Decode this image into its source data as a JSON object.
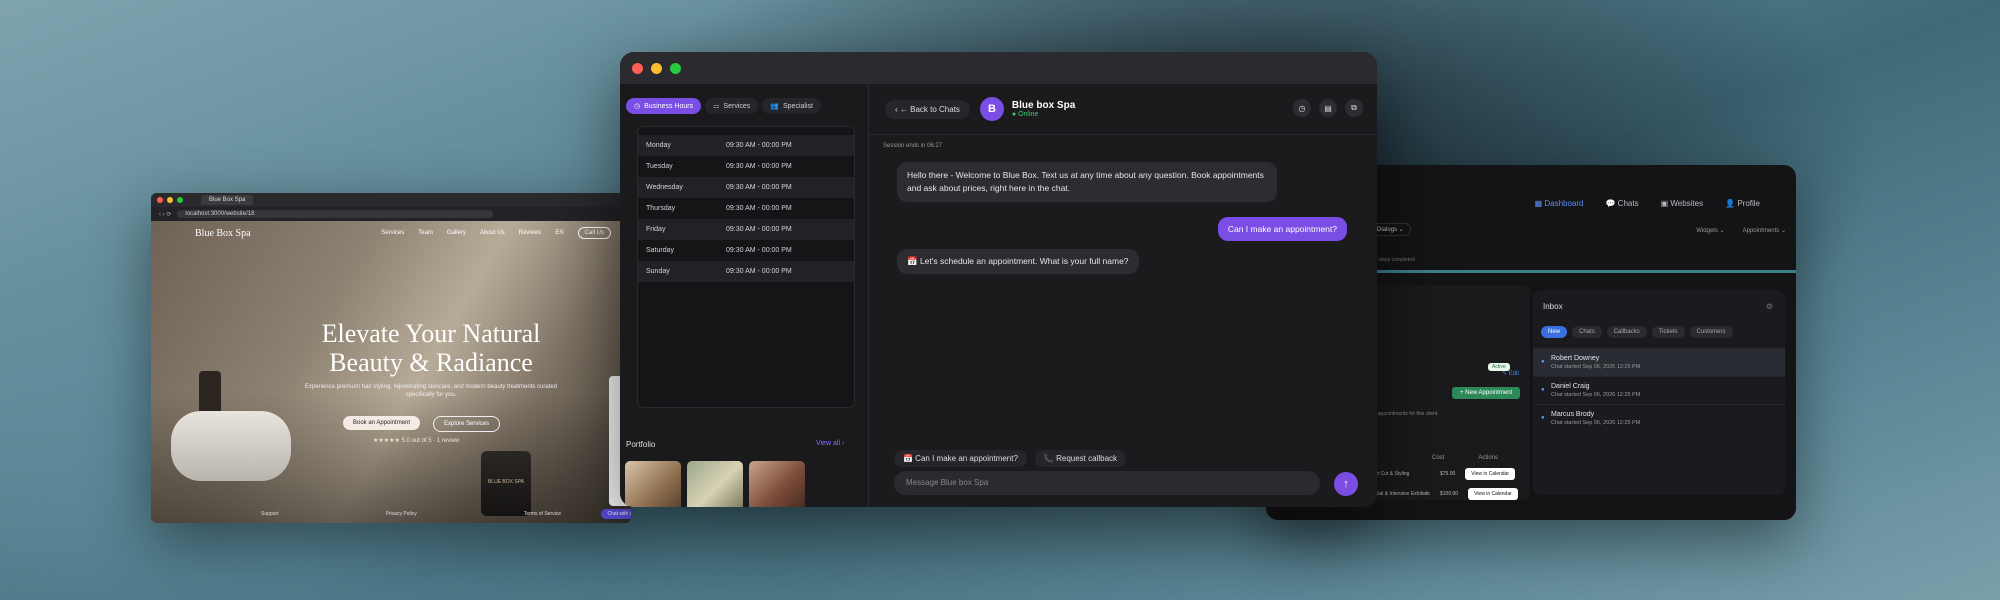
{
  "colors": {
    "accent": "#7a4de4",
    "online": "#45c476",
    "dashboard_accent": "#5f8df5"
  },
  "left": {
    "tab_title": "Blue Box Spa",
    "url": "localhost:3000/website/18",
    "brand": "Blue Box Spa",
    "nav": [
      "Services",
      "Team",
      "Gallery",
      "About Us",
      "Reviews",
      "EN"
    ],
    "call_label": "Call Us",
    "headline": "Elevate Your Natural Beauty & Radiance",
    "subtext": "Experience premium hair styling, rejuvenating skincare, and modern beauty treatments curated specifically for you.",
    "cta_primary": "Book an Appointment",
    "cta_secondary": "Explore Services",
    "rating_stars": "★★★★★",
    "rating_text": "5.0 out of 5 · 1 review",
    "jar_label": "BLUE BOX SPA",
    "footer": [
      "Support",
      "Privacy Policy",
      "Terms of Service"
    ],
    "chat_pill": "Chat with us"
  },
  "center": {
    "tabs": [
      {
        "label": "Business Hours",
        "icon": "clock-icon"
      },
      {
        "label": "Services",
        "icon": "services-icon"
      },
      {
        "label": "Specialist",
        "icon": "people-icon"
      }
    ],
    "hours": [
      {
        "day": "Monday",
        "time": "09:30 AM - 00:00 PM"
      },
      {
        "day": "Tuesday",
        "time": "09:30 AM - 00:00 PM"
      },
      {
        "day": "Wednesday",
        "time": "09:30 AM - 00:00 PM"
      },
      {
        "day": "Thursday",
        "time": "09:30 AM - 00:00 PM"
      },
      {
        "day": "Friday",
        "time": "09:30 AM - 00:00 PM"
      },
      {
        "day": "Saturday",
        "time": "09:30 AM - 00:00 PM"
      },
      {
        "day": "Sunday",
        "time": "09:30 AM - 00:00 PM"
      }
    ],
    "portfolio_label": "Portfolio",
    "view_all": "View all ›",
    "back_label": "Back to Chats",
    "avatar_letter": "B",
    "contact_name": "Blue box Spa",
    "contact_status": "● Online",
    "session": "Session ends in 06:27",
    "bot_msg_1": "Hello there - Welcome to Blue Box. Text us at any time about any question. Book appointments and ask about prices, right here in the chat.",
    "user_msg_1": "Can I make an appointment?",
    "bot_msg_2": "📅 Let's schedule an appointment. What is your full name?",
    "suggestion_1": "📅 Can I make an appointment?",
    "suggestion_2": "📞 Request callback",
    "composer_placeholder": "Message Blue box Spa",
    "send_icon": "↑"
  },
  "right": {
    "nav": [
      {
        "label": "Dashboard",
        "active": true
      },
      {
        "label": "Chats"
      },
      {
        "label": "Websites"
      },
      {
        "label": "Profile"
      }
    ],
    "account_chip": "Dialogs ⌄",
    "filters": [
      "Widgets ⌄",
      "Appointments ⌄"
    ],
    "progress_text": "3/4 steps completed",
    "badge": "Active",
    "edit_label": "✎ Edit",
    "new_appointment": "+ New Appointment",
    "no_appointments": "No appointments for this client.",
    "table_headers": [
      "Cost",
      "Actions"
    ],
    "rows": [
      {
        "service": "Hair Cut & Styling",
        "cost": "$75.00",
        "action": "View in Calendar"
      },
      {
        "service": "Facial & Intensive Exfoliation",
        "cost": "$100.00",
        "action": "View in Calendar"
      }
    ],
    "inbox_title": "Inbox",
    "chips": [
      {
        "label": "New",
        "on": true
      },
      {
        "label": "Chats"
      },
      {
        "label": "Callbacks"
      },
      {
        "label": "Tickets"
      },
      {
        "label": "Customers"
      }
    ],
    "items": [
      {
        "name": "Robert Downey",
        "meta": "Chat started Sep 06, 2026 12:25 PM"
      },
      {
        "name": "Daniel Craig",
        "meta": "Chat started Sep 06, 2026 12:25 PM"
      },
      {
        "name": "Marcus Brody",
        "meta": "Chat started Sep 06, 2026 12:25 PM"
      }
    ]
  }
}
